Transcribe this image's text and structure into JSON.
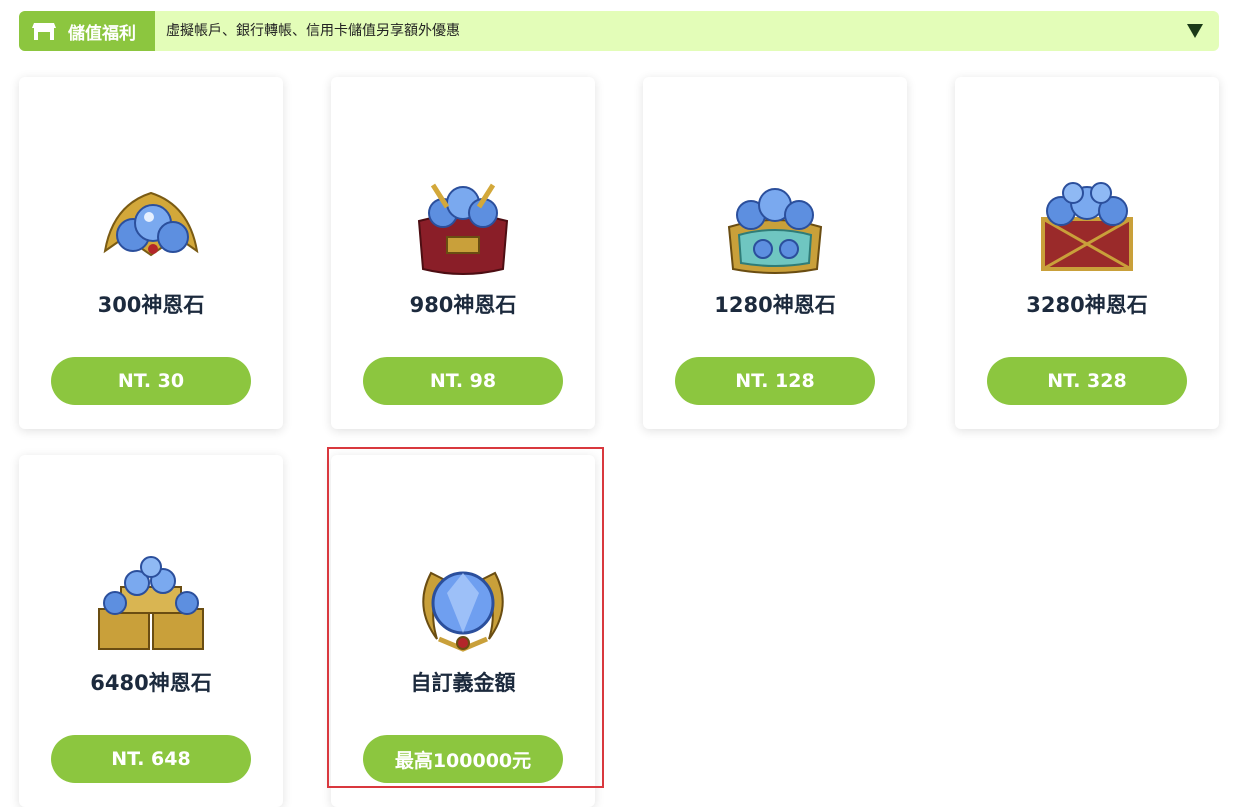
{
  "banner": {
    "tag_label": "儲值福利",
    "text": "虛擬帳戶、銀行轉帳、信用卡儲值另享額外優惠",
    "tag_icon": "store-icon",
    "toggle_icon": "triangle-down-icon"
  },
  "products": [
    {
      "name": "300神恩石",
      "price": "NT. 30",
      "icon": "gem-small-pile-icon"
    },
    {
      "name": "980神恩石",
      "price": "NT. 98",
      "icon": "gem-bag-icon"
    },
    {
      "name": "1280神恩石",
      "price": "NT. 128",
      "icon": "gem-ornate-bag-icon"
    },
    {
      "name": "3280神恩石",
      "price": "NT. 328",
      "icon": "gem-chest-icon"
    },
    {
      "name": "6480神恩石",
      "price": "NT. 648",
      "icon": "gem-chests-icon"
    },
    {
      "name": "自訂義金額",
      "price": "最高100000元",
      "icon": "gem-single-icon"
    }
  ],
  "colors": {
    "accent": "#8cc63f",
    "banner_bg": "#e3fdb8",
    "highlight": "#d9383e",
    "title": "#1c2a3d"
  }
}
